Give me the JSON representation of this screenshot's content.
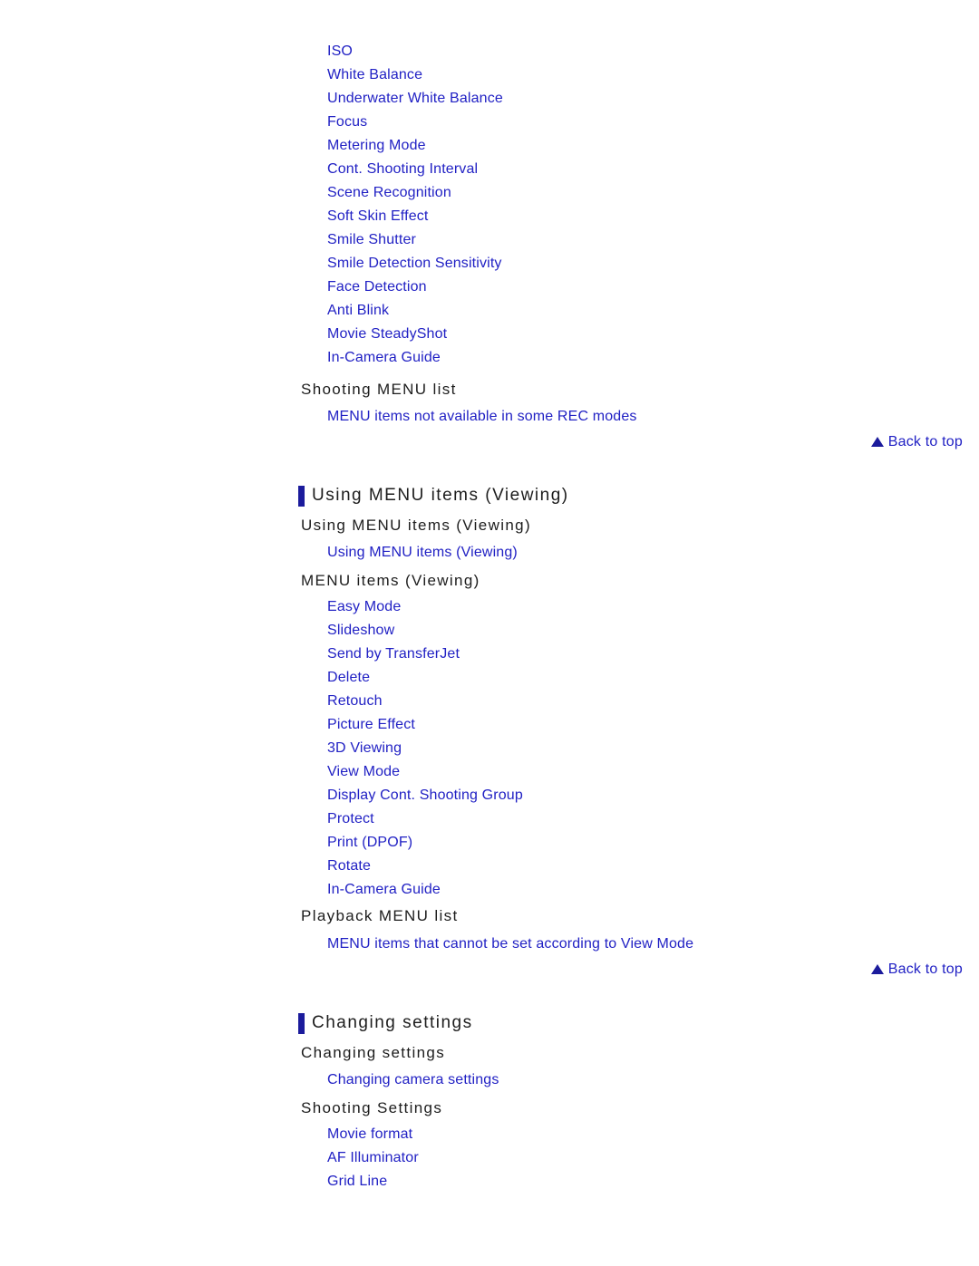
{
  "colors": {
    "link": "#2121c4",
    "heading": "#1d1d1d",
    "accent_bar": "#1b1b9c",
    "background": "#ffffff"
  },
  "shooting_menu_items": [
    "ISO",
    "White Balance",
    "Underwater White Balance",
    "Focus",
    "Metering Mode",
    "Cont. Shooting Interval",
    "Scene Recognition",
    "Soft Skin Effect",
    "Smile Shutter",
    "Smile Detection Sensitivity",
    "Face Detection",
    "Anti Blink",
    "Movie SteadyShot",
    "In-Camera Guide"
  ],
  "shooting_menu_list": {
    "heading": "Shooting MENU list",
    "links": [
      "MENU items not available in some REC modes"
    ]
  },
  "back_to_top_1": {
    "icon": "triangle-up-icon",
    "label": "Back to top"
  },
  "viewing_section": {
    "section_heading": "Using MENU items (Viewing)",
    "sub_heading_1": "Using MENU items (Viewing)",
    "links_1": [
      "Using MENU items (Viewing)"
    ],
    "sub_heading_2": "MENU items (Viewing)",
    "items": [
      "Easy Mode",
      "Slideshow",
      "Send by TransferJet",
      "Delete",
      "Retouch",
      "Picture Effect",
      "3D Viewing",
      "View Mode",
      "Display Cont. Shooting Group",
      "Protect",
      "Print (DPOF)",
      "Rotate",
      "In-Camera Guide"
    ],
    "sub_heading_3": "Playback MENU list",
    "links_3": [
      "MENU items that cannot be set according to View Mode"
    ]
  },
  "back_to_top_2": {
    "icon": "triangle-up-icon",
    "label": "Back to top"
  },
  "changing_section": {
    "section_heading": "Changing settings",
    "sub_heading_1": "Changing settings",
    "links_1": [
      "Changing camera settings"
    ],
    "sub_heading_2": "Shooting Settings",
    "items": [
      "Movie format",
      "AF Illuminator",
      "Grid Line"
    ]
  }
}
